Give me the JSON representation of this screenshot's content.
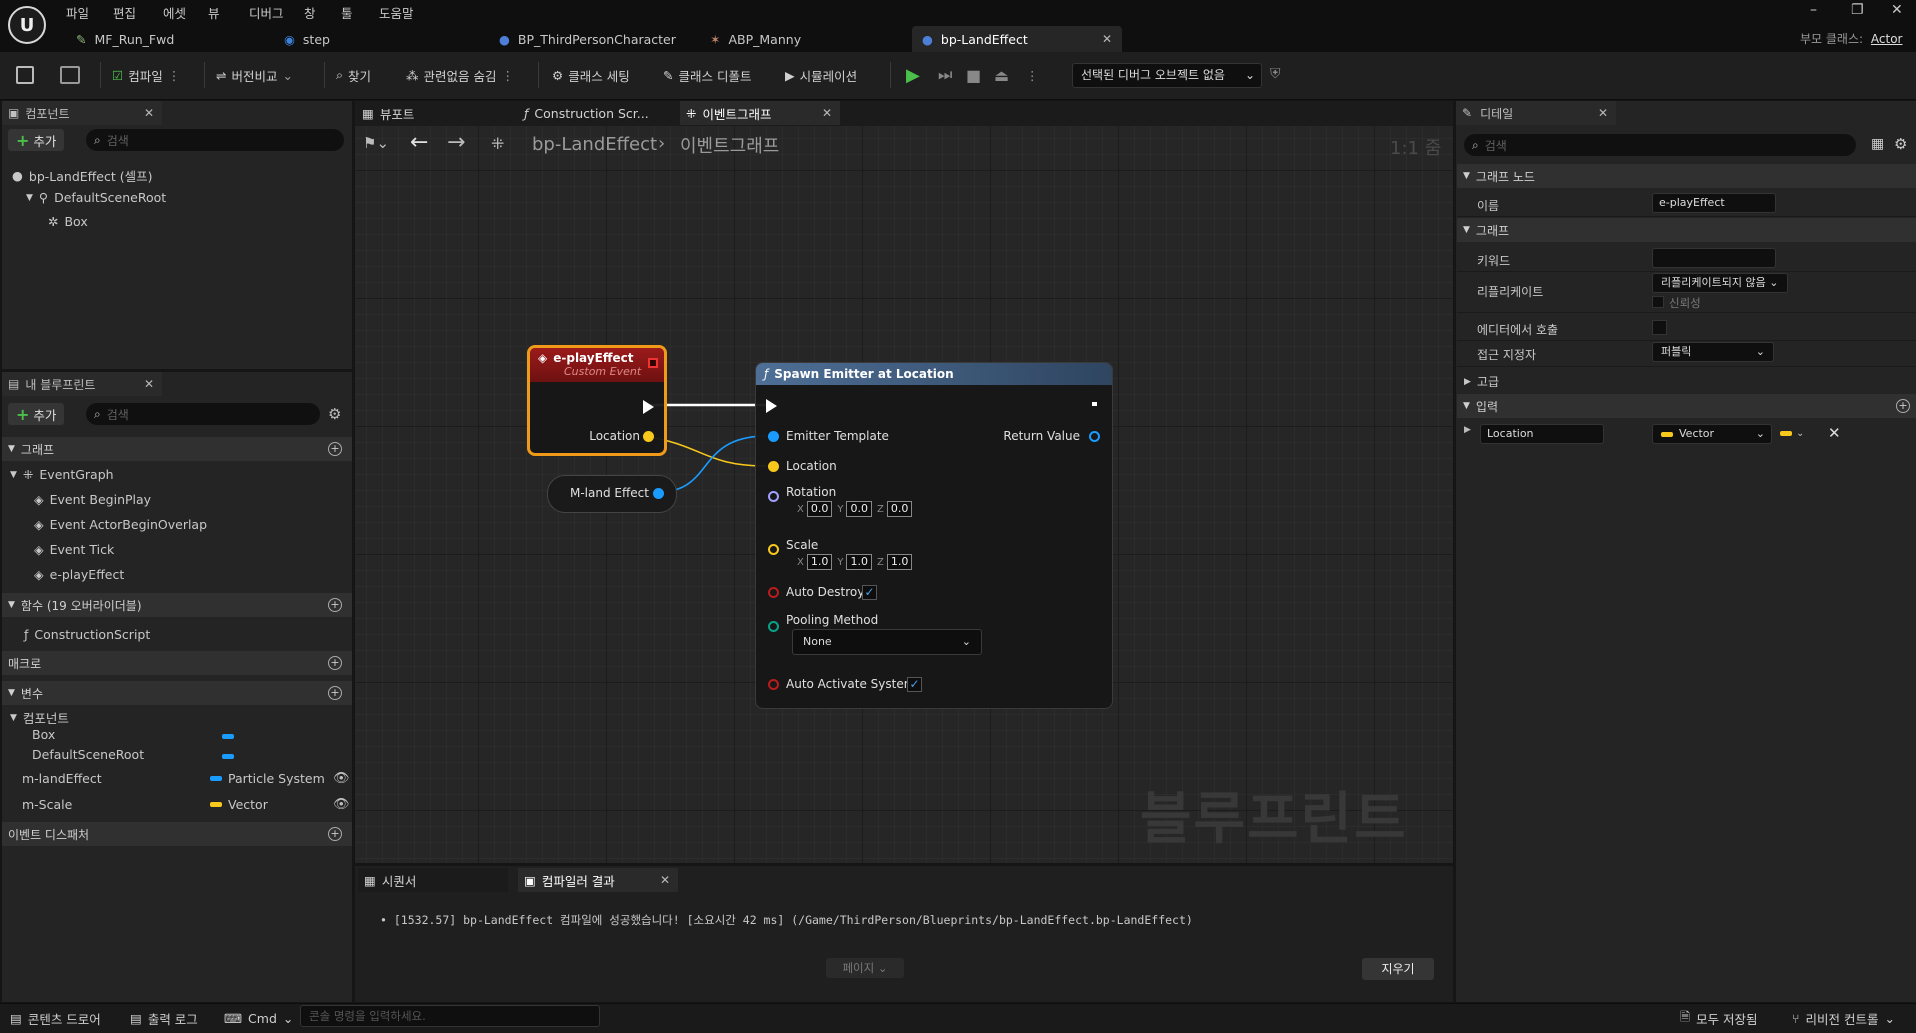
{
  "menu": [
    "파일",
    "편집",
    "에셋",
    "뷰",
    "디버그",
    "창",
    "툴",
    "도움말"
  ],
  "tabs": [
    {
      "label": "MF_Run_Fwd",
      "active": false
    },
    {
      "label": "step",
      "active": false
    },
    {
      "label": "BP_ThirdPersonCharacter",
      "active": false
    },
    {
      "label": "ABP_Manny",
      "active": false
    },
    {
      "label": "bp-LandEffect",
      "active": true
    }
  ],
  "parent_class": {
    "label": "부모 클래스:",
    "value": "Actor"
  },
  "toolbar": {
    "compile": "컴파일",
    "diff": "버전비교",
    "find": "찾기",
    "hide_unrelated": "관련없음 숨김",
    "class_settings": "클래스 세팅",
    "class_defaults": "클래스 디폴트",
    "simulation": "시뮬레이션",
    "debug_object": "선택된 디버그 오브젝트 없음"
  },
  "components_panel": {
    "title": "컴포넌트",
    "add": "추가",
    "search_placeholder": "검색",
    "self": "bp-LandEffect (셀프)",
    "root": "DefaultSceneRoot",
    "child": "Box"
  },
  "my_blueprint": {
    "title": "내 블루프린트",
    "add": "추가",
    "search_placeholder": "검색",
    "graphs_label": "그래프",
    "event_graph": "EventGraph",
    "events": [
      "Event BeginPlay",
      "Event ActorBeginOverlap",
      "Event Tick",
      "e-playEffect"
    ],
    "functions_label": "함수 (19 오버라이더블)",
    "construction": "ConstructionScript",
    "macros_label": "매크로",
    "variables_label": "변수",
    "components_label": "컴포넌트",
    "comp_vars": [
      "Box",
      "DefaultSceneRoot"
    ],
    "vars": [
      {
        "name": "m-landEffect",
        "type": "Particle System",
        "color": "#1a9cff"
      },
      {
        "name": "m-Scale",
        "type": "Vector",
        "color": "#f8c81c"
      }
    ],
    "dispatchers_label": "이벤트 디스패처"
  },
  "graph_tabs": {
    "viewport": "뷰포트",
    "construction": "Construction Scr...",
    "event_graph": "이벤트그래프"
  },
  "breadcrumb": {
    "blueprint": "bp-LandEffect",
    "graph": "이벤트그래프",
    "zoom": "1:1 줌"
  },
  "nodes": {
    "custom_event": {
      "title": "e-playEffect",
      "subtitle": "Custom Event",
      "pin": "Location"
    },
    "variable": {
      "label": "M-land Effect"
    },
    "spawn": {
      "title": "Spawn Emitter at Location",
      "emitter": "Emitter Template",
      "location": "Location",
      "return": "Return Value",
      "rotation": "Rotation",
      "rot": [
        "0.0",
        "0.0",
        "0.0"
      ],
      "scale": "Scale",
      "scl": [
        "1.0",
        "1.0",
        "1.0"
      ],
      "auto_destroy": "Auto Destroy",
      "pooling": "Pooling Method",
      "pooling_value": "None",
      "auto_activate": "Auto Activate System",
      "axes": [
        "X",
        "Y",
        "Z"
      ]
    }
  },
  "watermark": "블루프린트",
  "bottom_tabs": {
    "sequencer": "시퀀서",
    "compiler": "컴파일러 결과"
  },
  "compiler_msg": "[1532.57] bp-LandEffect 컴파일에 성공했습니다! [소요시간 42 ms] (/Game/ThirdPerson/Blueprints/bp-LandEffect.bp-LandEffect)",
  "page_btn": "페이지",
  "clear_btn": "지우기",
  "details": {
    "title": "디테일",
    "search_placeholder": "검색",
    "graph_node": "그래프 노드",
    "name_label": "이름",
    "name_value": "e-playEffect",
    "graph": "그래프",
    "keywords": "키워드",
    "replicate": "리플리케이트",
    "replicate_value": "리플리케이트되지 않음",
    "reliable": "신뢰성",
    "call_in_editor": "에디터에서 호출",
    "access": "접근 지정자",
    "access_value": "퍼블릭",
    "advanced": "고급",
    "inputs": "입력",
    "input_name": "Location",
    "input_type": "Vector"
  },
  "status": {
    "content_drawer": "콘텐츠 드로어",
    "output_log": "출력 로그",
    "cmd": "Cmd",
    "cmd_placeholder": "콘솔 명령을 입력하세요.",
    "save_all": "모두 저장됨",
    "revision": "리비전 컨트롤"
  }
}
